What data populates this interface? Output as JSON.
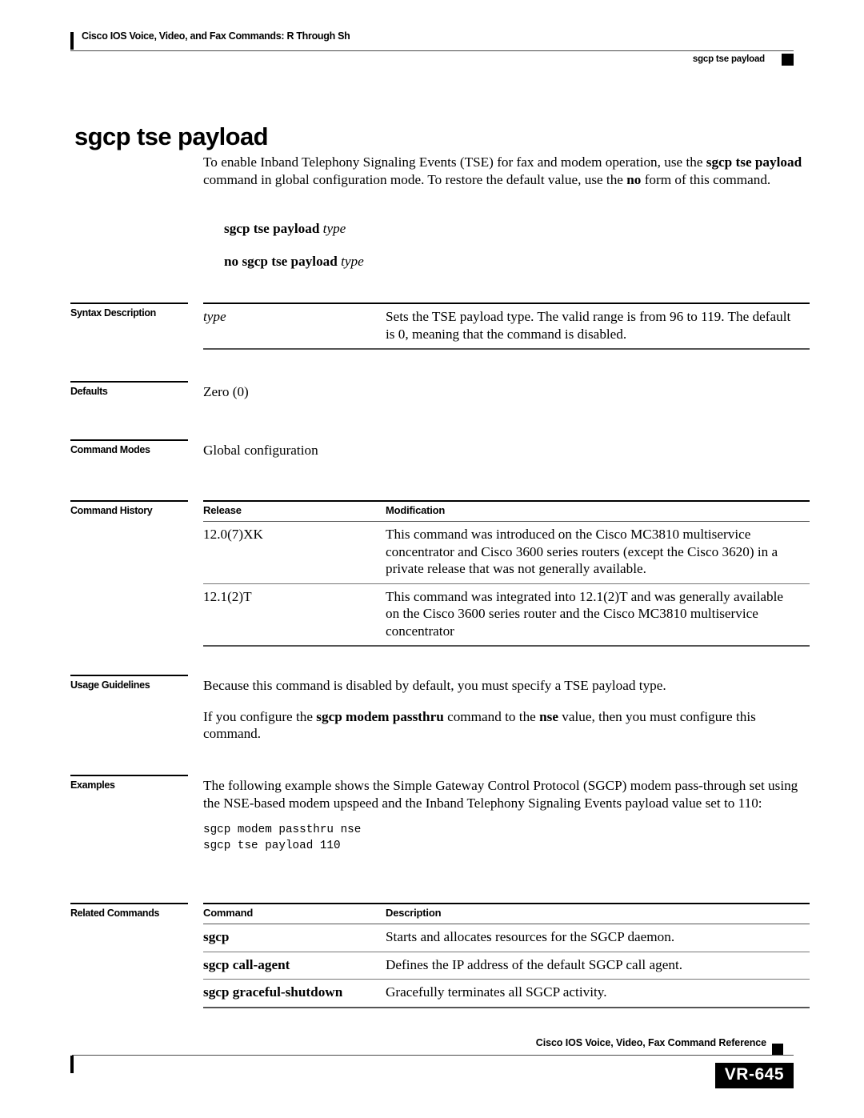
{
  "header": {
    "running_head_left": "Cisco IOS Voice, Video, and Fax Commands: R Through Sh",
    "running_head_right": "sgcp tse payload"
  },
  "title": "sgcp tse payload",
  "intro": {
    "part1": "To enable Inband Telephony Signaling Events (TSE) for fax and modem operation, use the ",
    "bold1": "sgcp tse payload",
    "part2": " command in global configuration mode. To restore the default value, use the ",
    "bold2": "no",
    "part3": " form of this command."
  },
  "syntax": {
    "line1_bold": "sgcp tse payload",
    "line1_italic": "type",
    "line2_bold": "no sgcp tse payload",
    "line2_italic": "type"
  },
  "sections": {
    "syntax_description": {
      "label": "Syntax Description",
      "rows": [
        {
          "term": "type",
          "description": "Sets the TSE payload type. The valid range is from 96 to 119. The default is 0, meaning that the command is disabled."
        }
      ]
    },
    "defaults": {
      "label": "Defaults",
      "value": "Zero (0)"
    },
    "command_modes": {
      "label": "Command Modes",
      "value": "Global configuration"
    },
    "command_history": {
      "label": "Command History",
      "columns": [
        "Release",
        "Modification"
      ],
      "rows": [
        {
          "release": "12.0(7)XK",
          "modification": "This command was introduced on the Cisco MC3810 multiservice concentrator and Cisco 3600 series routers (except the Cisco 3620) in a private release that was not generally available."
        },
        {
          "release": "12.1(2)T",
          "modification": "This command was integrated into 12.1(2)T and was generally available on the Cisco 3600 series router and the Cisco MC3810 multiservice concentrator"
        }
      ]
    },
    "usage_guidelines": {
      "label": "Usage Guidelines",
      "para1": "Because this command is disabled by default, you must specify a TSE payload type.",
      "para2_part1": "If you configure the ",
      "para2_bold1": "sgcp modem passthru",
      "para2_part2": " command to the ",
      "para2_bold2": "nse",
      "para2_part3": " value, then you must configure this command."
    },
    "examples": {
      "label": "Examples",
      "para1": "The following example shows the Simple Gateway Control Protocol (SGCP) modem pass-through set using the NSE-based modem upspeed and the Inband Telephony Signaling Events payload value set to 110:",
      "code": "sgcp modem passthru nse\nsgcp tse payload 110"
    },
    "related_commands": {
      "label": "Related Commands",
      "columns": [
        "Command",
        "Description"
      ],
      "rows": [
        {
          "command": "sgcp",
          "description": "Starts and allocates resources for the SGCP daemon."
        },
        {
          "command": "sgcp call-agent",
          "description": "Defines the IP address of the default SGCP call agent."
        },
        {
          "command": "sgcp graceful-shutdown",
          "description": "Gracefully terminates all SGCP activity."
        }
      ]
    }
  },
  "footer": {
    "text": "Cisco IOS Voice, Video, Fax Command Reference",
    "page_number": "VR-645"
  },
  "colors": {
    "ink": "#000000",
    "paper": "#ffffff",
    "rule": "#4a4a4a"
  }
}
